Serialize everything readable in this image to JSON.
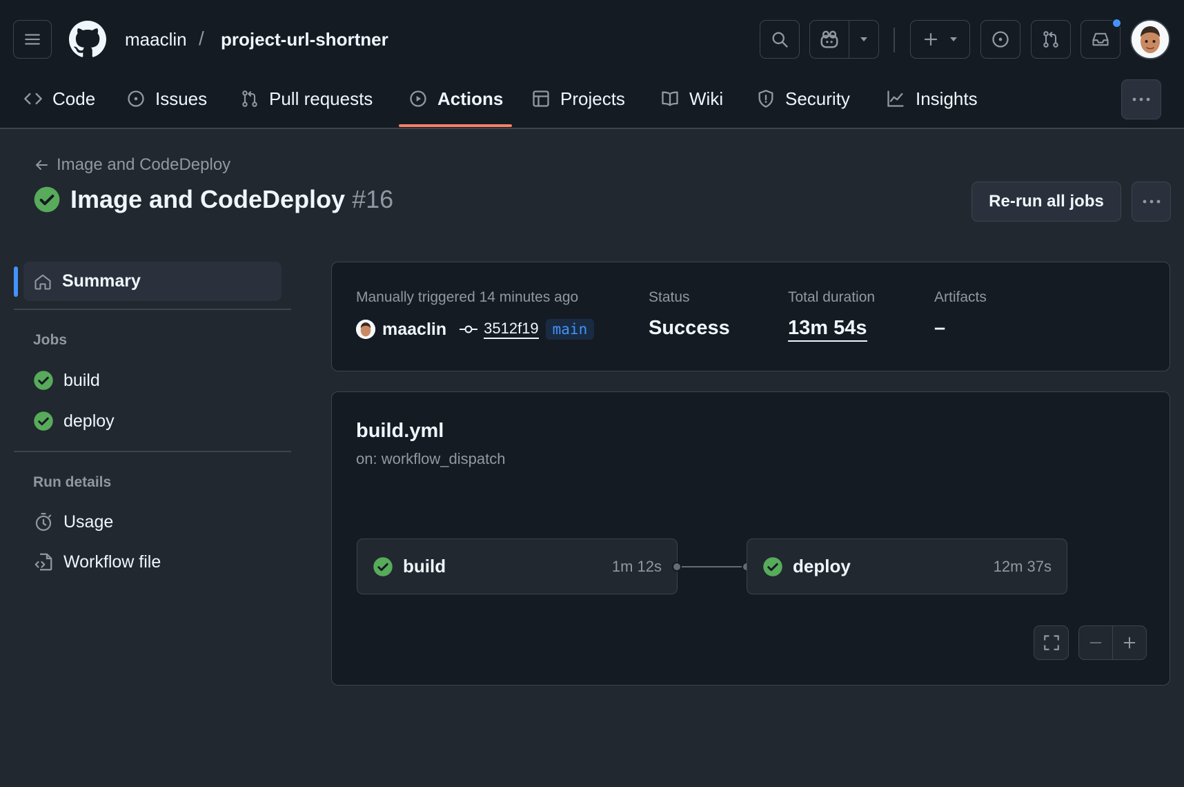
{
  "header": {
    "owner": "maaclin",
    "separator": "/",
    "repo": "project-url-shortner"
  },
  "tabs": [
    {
      "label": "Code",
      "icon": "code-icon"
    },
    {
      "label": "Issues",
      "icon": "issue-opened-icon"
    },
    {
      "label": "Pull requests",
      "icon": "git-pull-request-icon"
    },
    {
      "label": "Actions",
      "icon": "play-icon",
      "active": true
    },
    {
      "label": "Projects",
      "icon": "table-icon"
    },
    {
      "label": "Wiki",
      "icon": "book-icon"
    },
    {
      "label": "Security",
      "icon": "shield-icon"
    },
    {
      "label": "Insights",
      "icon": "graph-icon"
    }
  ],
  "run": {
    "back_label": "Image and CodeDeploy",
    "title": "Image and CodeDeploy",
    "number": "#16",
    "rerun_label": "Re-run all jobs"
  },
  "sidebar": {
    "summary": "Summary",
    "jobs_heading": "Jobs",
    "jobs": [
      "build",
      "deploy"
    ],
    "details_heading": "Run details",
    "usage": "Usage",
    "workflow_file": "Workflow file"
  },
  "summary": {
    "trigger_label": "Manually triggered 14 minutes ago",
    "actor": "maaclin",
    "commit": "3512f19",
    "branch": "main",
    "status_label": "Status",
    "status_value": "Success",
    "duration_label": "Total duration",
    "duration_value": "13m 54s",
    "artifacts_label": "Artifacts",
    "artifacts_value": "–"
  },
  "workflow": {
    "name": "build.yml",
    "trigger": "on: workflow_dispatch",
    "jobs": [
      {
        "name": "build",
        "duration": "1m 12s",
        "status": "success"
      },
      {
        "name": "deploy",
        "duration": "12m 37s",
        "status": "success"
      }
    ]
  },
  "colors": {
    "success": "#57ab5a",
    "accent": "#4493f8",
    "tab_underline": "#f78166"
  }
}
